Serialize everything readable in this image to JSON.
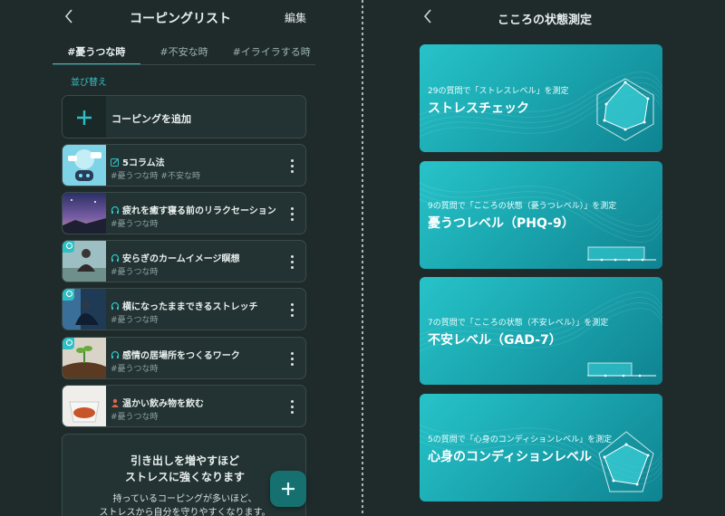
{
  "left": {
    "title": "コーピングリスト",
    "edit_label": "編集",
    "tabs": [
      {
        "label": "#憂うつな時",
        "active": true
      },
      {
        "label": "#不安な時",
        "active": false
      },
      {
        "label": "#イライラする時",
        "active": false
      }
    ],
    "sort_label": "並び替え",
    "add_label": "コーピングを追加",
    "items": [
      {
        "name": "5コラム法",
        "tags": "#憂うつな時 #不安な時",
        "icon": "pencil-icon"
      },
      {
        "name": "疲れを癒す寝る前のリラクセーション",
        "tags": "#憂うつな時",
        "icon": "headphones-icon"
      },
      {
        "name": "安らぎのカームイメージ瞑想",
        "tags": "#憂うつな時",
        "icon": "headphones-icon"
      },
      {
        "name": "横になったままできるストレッチ",
        "tags": "#憂うつな時",
        "icon": "headphones-icon"
      },
      {
        "name": "感情の居場所をつくるワーク",
        "tags": "#憂うつな時",
        "icon": "headphones-icon"
      },
      {
        "name": "温かい飲み物を飲む",
        "tags": "#憂うつな時",
        "icon": "person-icon"
      }
    ],
    "promo": {
      "title_line1": "引き出しを増やすほど",
      "title_line2": "ストレスに強くなります",
      "text_line1": "持っているコーピングが多いほど、",
      "text_line2": "ストレスから自分を守りやすくなります。"
    }
  },
  "right": {
    "title": "こころの状態測定",
    "cards": [
      {
        "subtitle": "29の質問で「ストレスレベル」を測定",
        "title": "ストレスチェック",
        "graphic": "radar-chart-icon"
      },
      {
        "subtitle": "9の質問で「こころの状態（憂うつレベル）」を測定",
        "title": "憂うつレベル（PHQ-9）",
        "graphic": "bar-chart-icon"
      },
      {
        "subtitle": "7の質問で「こころの状態（不安レベル）」を測定",
        "title": "不安レベル（GAD-7）",
        "graphic": "bar-chart-icon"
      },
      {
        "subtitle": "5の質問で「心身のコンディションレベル」を測定",
        "title": "心身のコンディションレベル",
        "graphic": "radar-chart-icon"
      }
    ]
  },
  "colors": {
    "background": "#1f2b2b",
    "card": "#233333",
    "accent": "#2ec0c4",
    "teal_card": "#1ba7b0"
  }
}
